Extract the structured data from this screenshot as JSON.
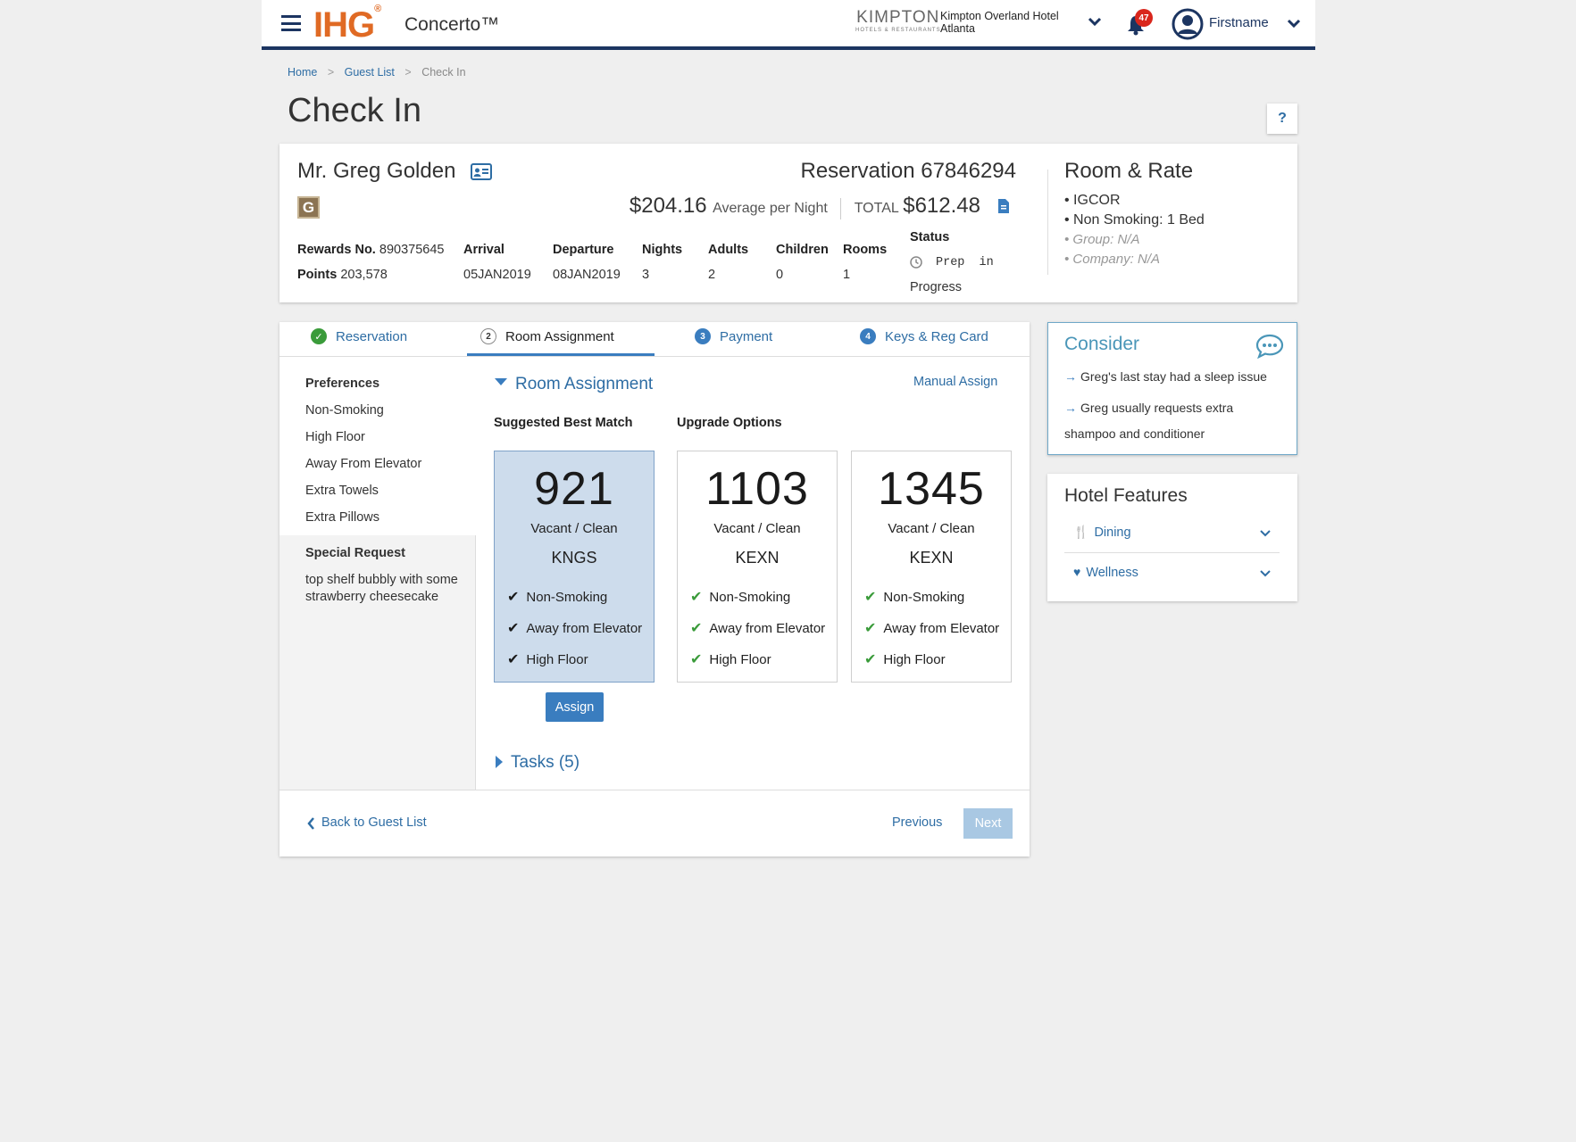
{
  "header": {
    "brand": "IHG",
    "brand_mark": "®",
    "product": "Concerto™",
    "partner_logo": "KIMPTON",
    "partner_sub": "HOTELS & RESTAURANTS",
    "hotel_line1": "Kimpton Overland Hotel",
    "hotel_line2": "Atlanta",
    "notif_count": "47",
    "username": "Firstname"
  },
  "breadcrumb": {
    "home": "Home",
    "sep": ">",
    "guest_list": "Guest List",
    "current": "Check In"
  },
  "page_title": "Check In",
  "help": "?",
  "guest": {
    "name": "Mr. Greg Golden",
    "badge": "G",
    "reservation": "Reservation 67846294",
    "avg_rate": "$204.16",
    "avg_label": "Average per Night",
    "total_label": "TOTAL",
    "total": "$612.48",
    "rewards_label": "Rewards No.",
    "rewards": "890375645",
    "points_label": "Points",
    "points": "203,578",
    "cols": [
      {
        "label": "Arrival",
        "value": "05JAN2019"
      },
      {
        "label": "Departure",
        "value": "08JAN2019"
      },
      {
        "label": "Nights",
        "value": "3"
      },
      {
        "label": "Adults",
        "value": "2"
      },
      {
        "label": "Children",
        "value": "0"
      },
      {
        "label": "Rooms",
        "value": "1"
      }
    ],
    "status_label": "Status",
    "status_line1": "Prep in",
    "status_line2": "Progress"
  },
  "room_rate": {
    "title": "Room & Rate",
    "items": [
      "IGCOR",
      "Non Smoking: 1 Bed"
    ],
    "muted": [
      "Group: N/A",
      "Company: N/A"
    ]
  },
  "tabs": [
    {
      "num": "✓",
      "label": "Reservation"
    },
    {
      "num": "2",
      "label": "Room Assignment"
    },
    {
      "num": "3",
      "label": "Payment"
    },
    {
      "num": "4",
      "label": "Keys & Reg Card"
    }
  ],
  "preferences": {
    "title": "Preferences",
    "items": [
      "Non-Smoking",
      "High Floor",
      "Away From Elevator",
      "Extra Towels",
      "Extra Pillows"
    ],
    "special_title": "Special Request",
    "special_line1": "top shelf bubbly with some",
    "special_line2": "strawberry cheesecake"
  },
  "room_assignment": {
    "title": "Room Assignment",
    "manual": "Manual Assign",
    "suggested": "Suggested Best Match",
    "upgrade": "Upgrade Options",
    "assign": "Assign",
    "tasks": "Tasks (5)",
    "rooms": [
      {
        "num": "921",
        "status": "Vacant / Clean",
        "type": "KNGS",
        "features": [
          "Non-Smoking",
          "Away from Elevator",
          "High Floor"
        ]
      },
      {
        "num": "1103",
        "status": "Vacant / Clean",
        "type": "KEXN",
        "features": [
          "Non-Smoking",
          "Away from Elevator",
          "High Floor"
        ]
      },
      {
        "num": "1345",
        "status": "Vacant / Clean",
        "type": "KEXN",
        "features": [
          "Non-Smoking",
          "Away from Elevator",
          "High Floor"
        ]
      }
    ]
  },
  "footer": {
    "back": "Back to Guest List",
    "previous": "Previous",
    "next": "Next"
  },
  "consider": {
    "title": "Consider",
    "item1": "Greg's last stay had a sleep issue",
    "item2_line1": "Greg usually requests extra",
    "item2_line2": "shampoo and conditioner"
  },
  "hotel_features": {
    "title": "Hotel Features",
    "items": [
      "Dining",
      "Wellness"
    ]
  },
  "colors": {
    "accent": "#2e6da4",
    "brand": "#e06a24",
    "navy": "#1c3561",
    "check_green": "#3a9b3a",
    "selected_room": "#cddcec"
  }
}
